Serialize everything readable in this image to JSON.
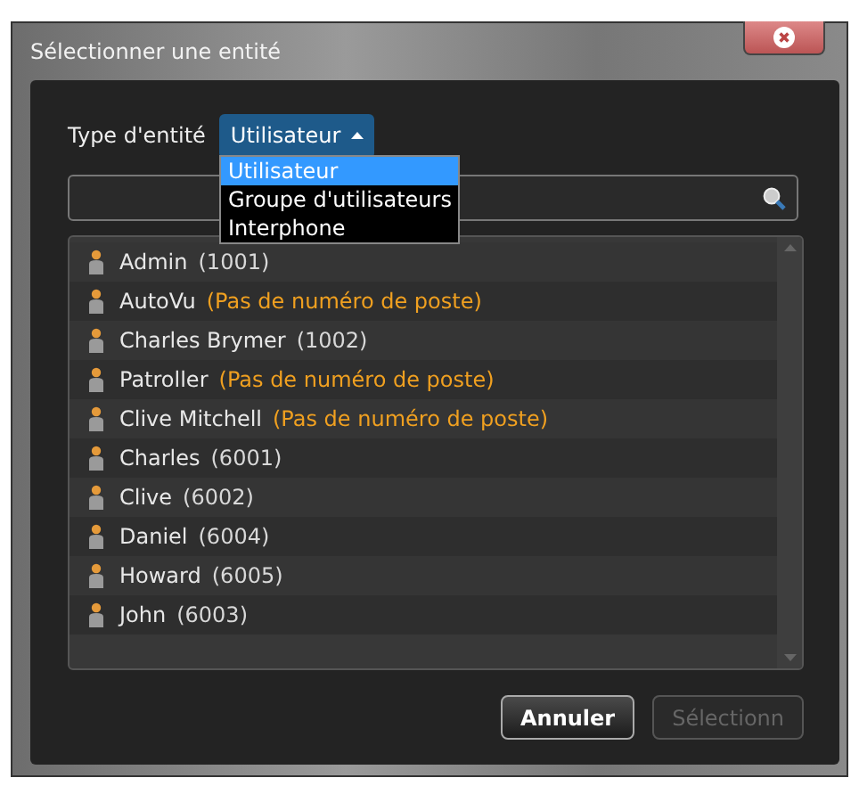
{
  "window": {
    "title": "Sélectionner une entité"
  },
  "entity_type": {
    "label": "Type d'entité",
    "value": "Utilisateur",
    "expanded": true,
    "options": [
      {
        "label": "Utilisateur",
        "selected": true
      },
      {
        "label": "Groupe d'utilisateurs",
        "selected": false
      },
      {
        "label": "Interphone",
        "selected": false
      }
    ]
  },
  "entities": [
    {
      "name": "Admin",
      "detail": "(1001)",
      "kind": "extension"
    },
    {
      "name": "AutoVu",
      "detail": "(Pas de numéro de poste)",
      "kind": "missing"
    },
    {
      "name": "Charles Brymer",
      "detail": "(1002)",
      "kind": "extension"
    },
    {
      "name": "Patroller",
      "detail": "(Pas de numéro de poste)",
      "kind": "missing"
    },
    {
      "name": "Clive Mitchell",
      "detail": "(Pas de numéro de poste)",
      "kind": "missing"
    },
    {
      "name": "Charles",
      "detail": "(6001)",
      "kind": "extension"
    },
    {
      "name": "Clive",
      "detail": "(6002)",
      "kind": "extension"
    },
    {
      "name": "Daniel",
      "detail": "(6004)",
      "kind": "extension"
    },
    {
      "name": "Howard",
      "detail": "(6005)",
      "kind": "extension"
    },
    {
      "name": "John",
      "detail": "(6003)",
      "kind": "extension"
    }
  ],
  "buttons": [
    {
      "label": "Annuler",
      "disabled": false
    },
    {
      "label": "Sélectionn",
      "disabled": true
    }
  ]
}
